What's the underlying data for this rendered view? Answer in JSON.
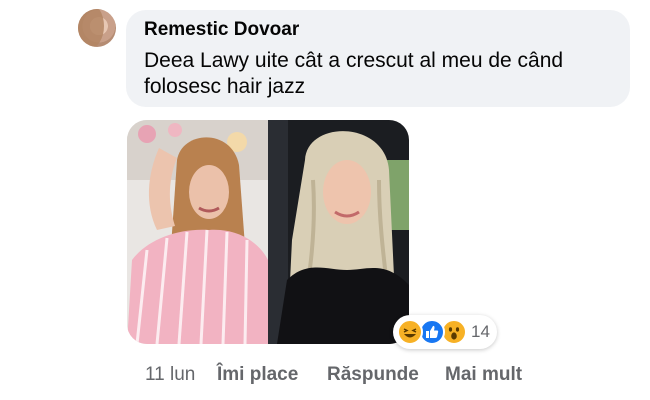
{
  "comment": {
    "author": "Remestic Dovoar",
    "text": "Deea Lawy uite cât a crescut al meu de când folosesc hair jazz",
    "reactions": {
      "icons": [
        "haha-icon",
        "like-icon",
        "wow-icon"
      ],
      "count": "14"
    },
    "actions": {
      "time": "11 lun",
      "like": "Îmi place",
      "reply": "Răspunde",
      "more": "Mai mult"
    }
  },
  "colors": {
    "bubble": "#f0f2f5",
    "secondary_text": "#65676b",
    "like_blue": "#1877f2",
    "reaction_yellow": "#f7b125"
  }
}
